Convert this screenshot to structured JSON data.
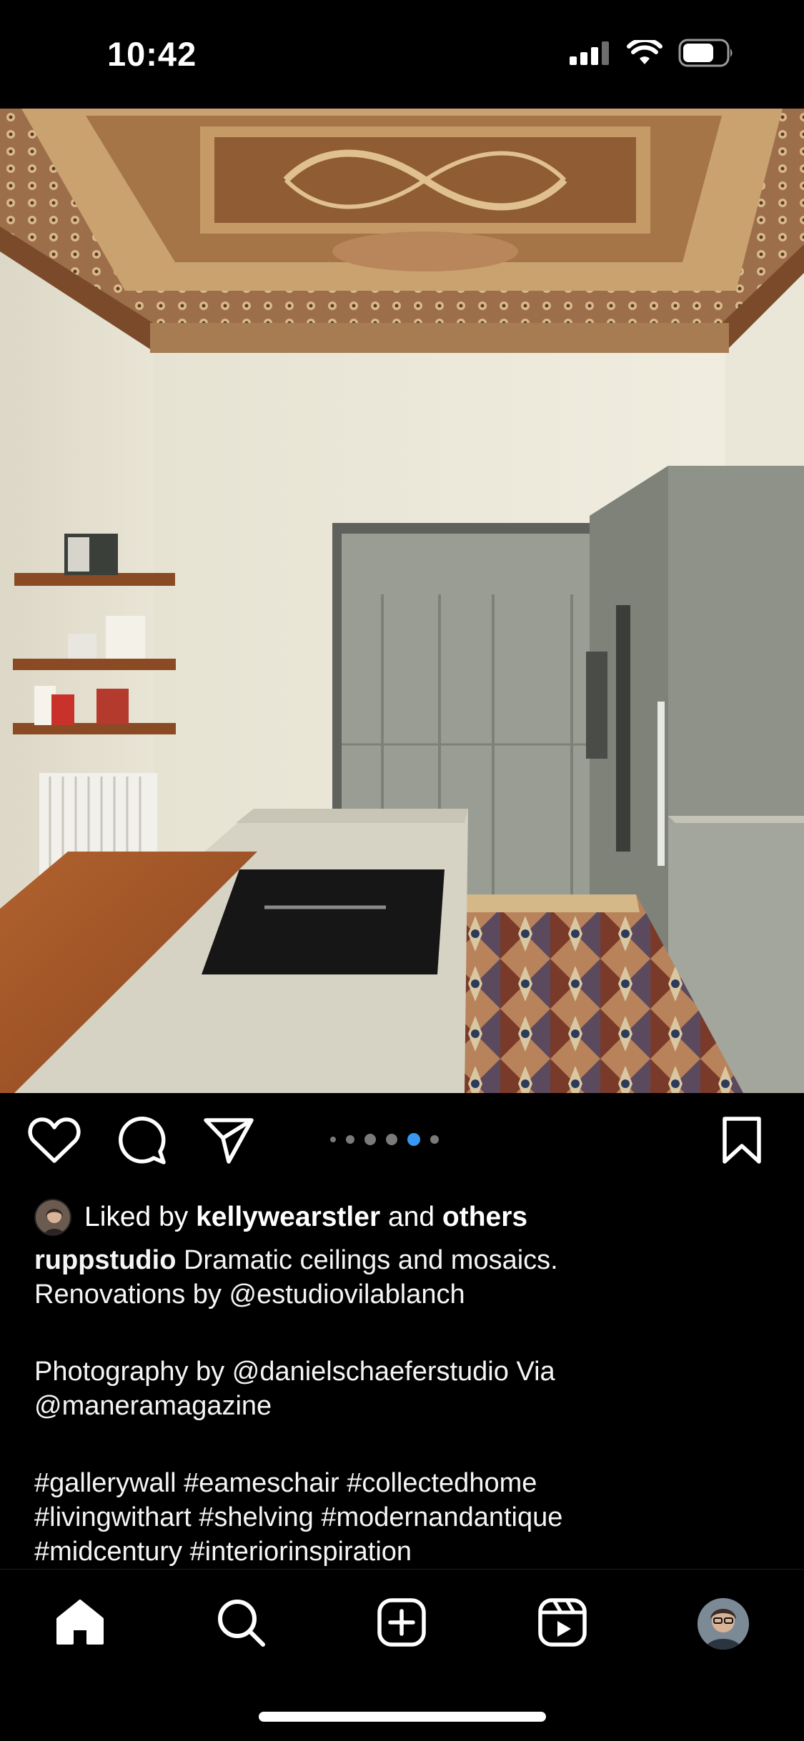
{
  "status_bar": {
    "time": "10:42",
    "icons": [
      "cellular-signal-icon",
      "wifi-icon",
      "battery-icon"
    ]
  },
  "post": {
    "image_alt": "Kitchen with ornate painted ceiling, island cooktop, wooden shelves and mosaic tiled floor",
    "carousel": {
      "count": 5,
      "active_index": 3
    },
    "actions": [
      "heart-icon",
      "comment-icon",
      "share-icon",
      "bookmark-icon"
    ],
    "likes": {
      "prefix": "Liked by",
      "user": "kellywearstler",
      "conjunction": "and",
      "others": "others"
    },
    "caption": {
      "author": "ruppstudio",
      "line1": "Dramatic ceilings and mosaics.",
      "line2": "Renovations by @estudiovilablanch",
      "line3": "Photography by @danielschaeferstudio Via",
      "line4": "@maneramagazine",
      "line5": "#gallerywall #eameschair #collectedhome",
      "line6": "#livingwithart #shelving #modernandantique",
      "line7": "#midcentury #interiorinspiration"
    }
  },
  "bottom_nav": {
    "items": [
      "home-icon",
      "search-icon",
      "create-post-icon",
      "reels-icon",
      "profile-avatar"
    ]
  },
  "colors": {
    "background": "#000000",
    "text": "#ffffff",
    "active_dot": "#3897f0",
    "inactive_dot": "#7a7a7a"
  }
}
